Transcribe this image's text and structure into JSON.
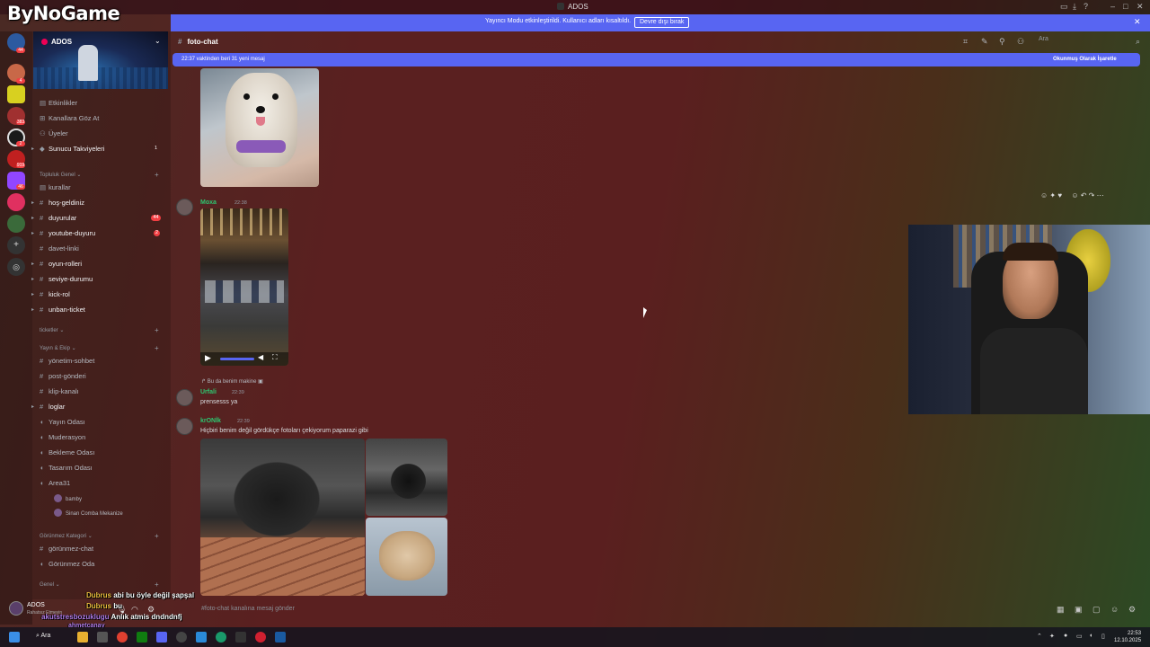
{
  "window": {
    "title": "ADOS"
  },
  "logo": {
    "text": "ByNoGame"
  },
  "stream_banner": {
    "message": "Yayıncı Modu etkinleştirildi. Kullanıcı adları kısaltıldı.",
    "button": "Devre dışı bırak"
  },
  "server": {
    "name": "ADOS"
  },
  "server_badges": [
    "44",
    "4",
    "383",
    "2",
    "919",
    "46"
  ],
  "sidebar": {
    "top_items": [
      {
        "label": "Etkinlikler"
      },
      {
        "label": "Kanallara Göz At"
      },
      {
        "label": "Üyeler"
      },
      {
        "label": "Sunucu Takviyeleri",
        "count": "1"
      }
    ],
    "categories": {
      "topluluk": "Topluluk Genel",
      "ticketler": "ticketler",
      "yayin": "Yayın & Ekip",
      "gorunmez": "Görünmez Kategori",
      "genel": "Genel"
    },
    "channels_topluluk": [
      {
        "label": "kurallar"
      },
      {
        "label": "hoş-geldiniz"
      },
      {
        "label": "duyurular",
        "badge": "44"
      },
      {
        "label": "youtube-duyuru",
        "badge": "2"
      },
      {
        "label": "davet-linki"
      },
      {
        "label": "oyun-rolleri"
      },
      {
        "label": "seviye-durumu"
      },
      {
        "label": "kick-rol"
      },
      {
        "label": "unban-ticket"
      }
    ],
    "channels_yayin": [
      {
        "label": "yönetim-sohbet"
      },
      {
        "label": "post-gönderi"
      },
      {
        "label": "klip-kanalı"
      },
      {
        "label": "loglar"
      },
      {
        "label": "Yayın Odası"
      },
      {
        "label": "Muderasyon"
      },
      {
        "label": "Bekleme Odası"
      },
      {
        "label": "Tasarım Odası"
      },
      {
        "label": "Area31"
      }
    ],
    "voice_users": [
      "bamby",
      "Sinan Comba Mekanize"
    ],
    "channels_gorunmez": [
      {
        "label": "görünmez-chat"
      },
      {
        "label": "Görünmez Oda"
      }
    ]
  },
  "user_panel": {
    "name": "ADOS",
    "status": "Rahatsız Etmeyin"
  },
  "stream_chat": [
    {
      "user": "Dubrus",
      "text": "abi bu öyle değil şapşal"
    },
    {
      "user": "Dubrus",
      "text": "bu"
    },
    {
      "user": "akutstresbozuklugu",
      "text": "Anlık atmis dndndnfj"
    },
    {
      "user": "ahmetcanay",
      "text": ""
    }
  ],
  "channel_header": {
    "name": "foto-chat",
    "search_placeholder": "Ara"
  },
  "new_messages_bar": {
    "left": "22:37 vaktinden beri 31 yeni mesaj",
    "right": "Okunmuş Olarak İşaretle"
  },
  "messages": [
    {
      "user": "Moxa",
      "time": "22:38",
      "color": "#2dc770"
    },
    {
      "reply_to": "Bu da benim makine",
      "user": "Urfali",
      "time": "22:39",
      "text": "prensesss ya",
      "color": "#2dc770"
    },
    {
      "user": "krONİk",
      "time": "22:39",
      "text": "Hiçbiri benim değil gördükçe fotoları çekiyorum paparazi gibi",
      "color": "#2dc770"
    }
  ],
  "composer": {
    "placeholder": "#foto-chat kanalına mesaj gönder"
  },
  "taskbar": {
    "search": "Ara",
    "time": "22:53",
    "date": "12.10.2025"
  }
}
